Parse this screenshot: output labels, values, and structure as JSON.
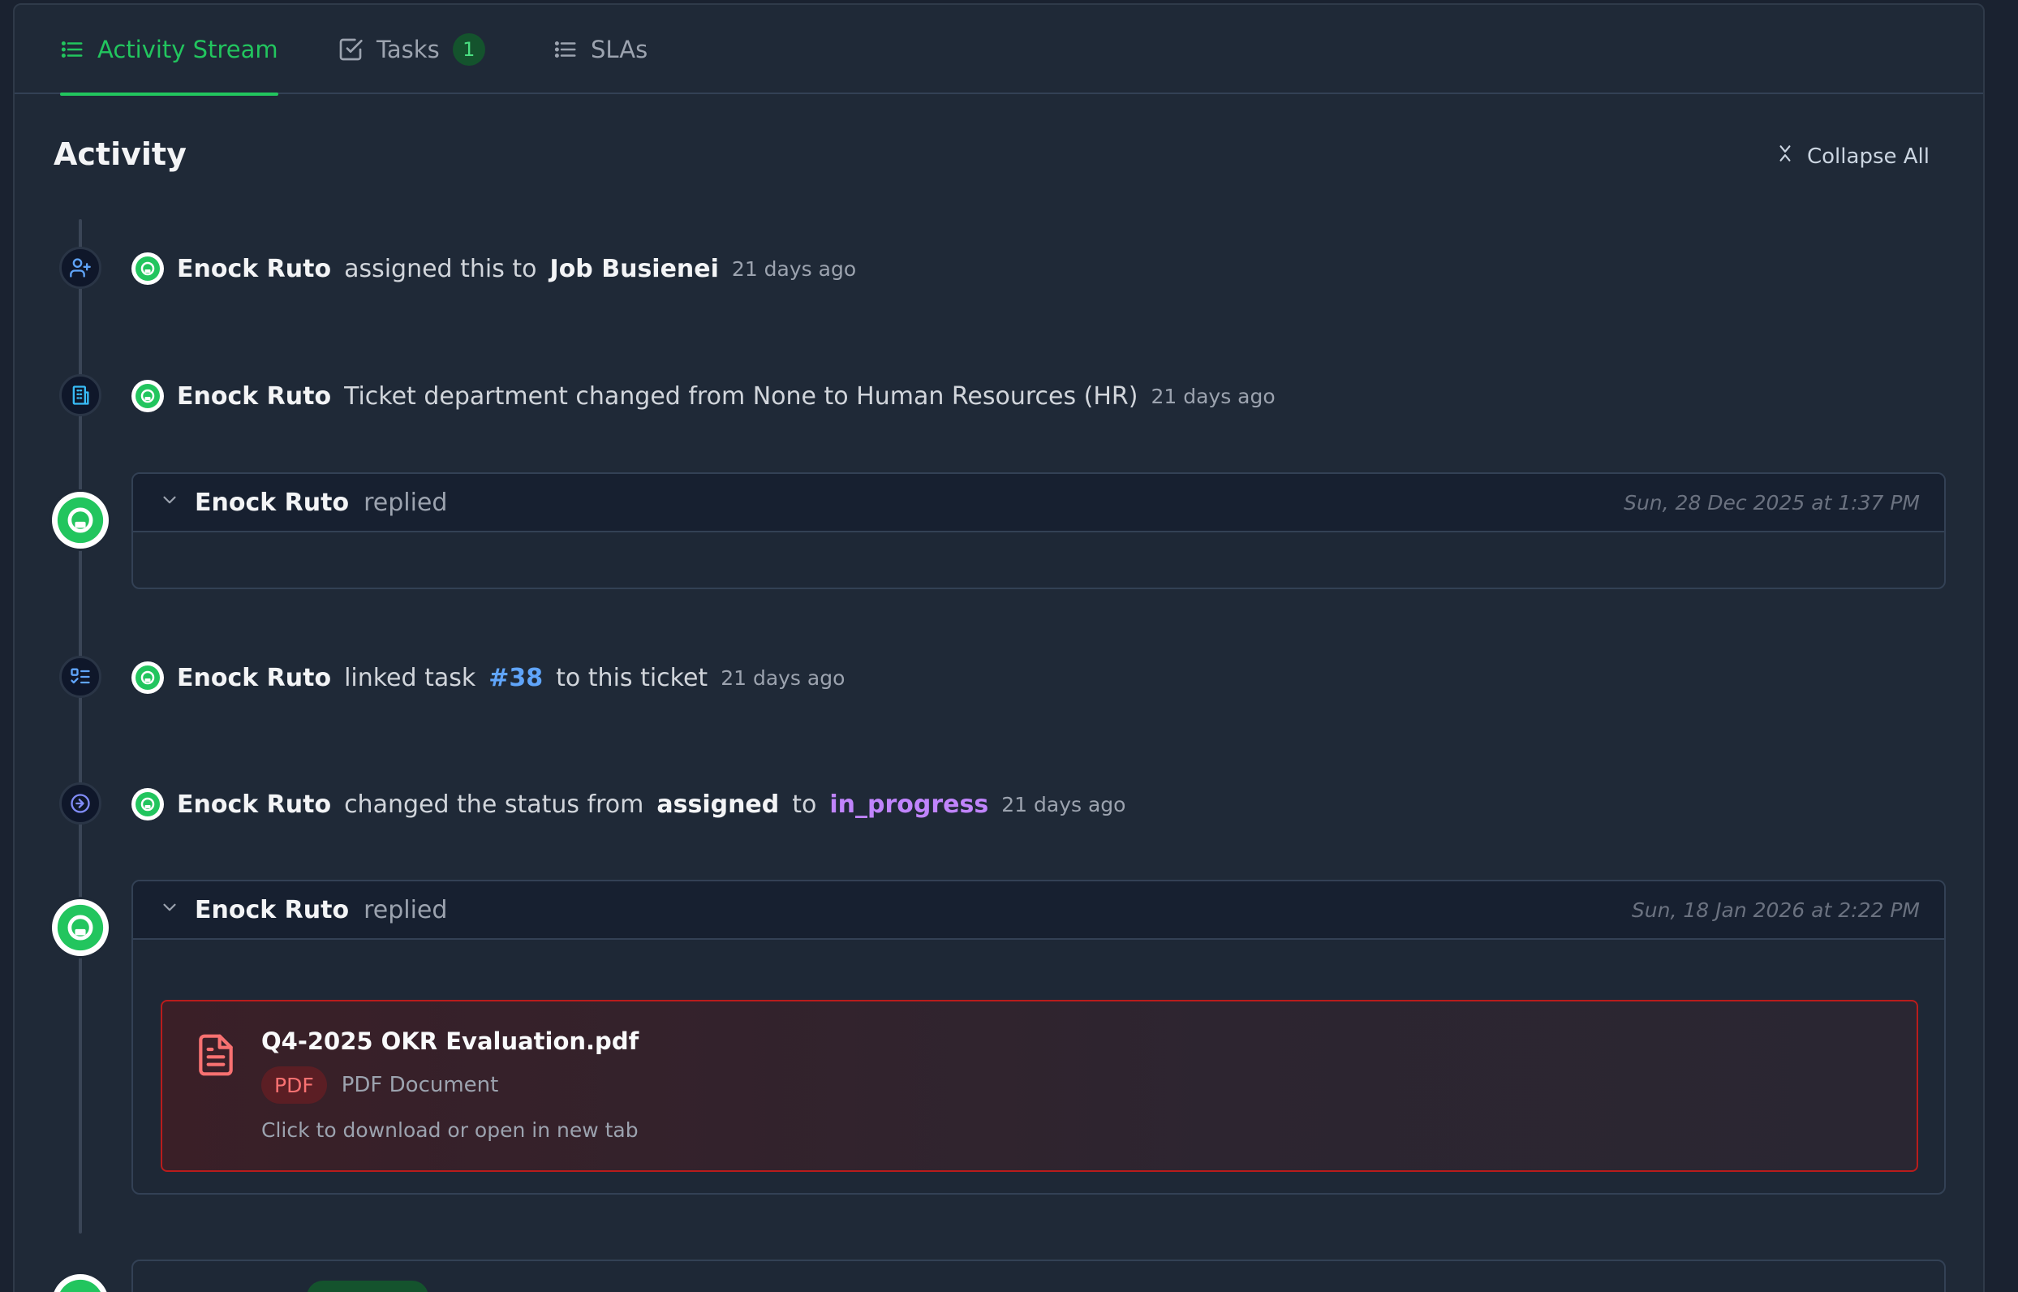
{
  "tabs": [
    {
      "label": "Activity Stream",
      "icon": "list-icon",
      "active": true
    },
    {
      "label": "Tasks",
      "icon": "checkbox-icon",
      "badge": "1",
      "active": false
    },
    {
      "label": "SLAs",
      "icon": "list-icon",
      "active": false
    }
  ],
  "activity": {
    "title": "Activity",
    "collapse_label": "Collapse All"
  },
  "events": [
    {
      "actor": "Enock Ruto",
      "text": "assigned this to",
      "target": "Job Busienei",
      "time": "21 days ago",
      "icon": "user-plus-icon"
    },
    {
      "actor": "Enock Ruto",
      "text": "Ticket department changed from None to Human Resources (HR)",
      "time": "21 days ago",
      "icon": "building-icon"
    },
    {
      "actor": "Enock Ruto",
      "verb": "replied",
      "date": "Sun, 28 Dec 2025 at 1:37 PM"
    },
    {
      "actor": "Enock Ruto",
      "text": "linked task",
      "task": "#38",
      "text2": "to this ticket",
      "time": "21 days ago",
      "icon": "task-list-icon"
    },
    {
      "actor": "Enock Ruto",
      "text": "changed the status from",
      "from": "assigned",
      "to_word": "to",
      "to": "in_progress",
      "time": "21 days ago",
      "icon": "arrow-circle-icon"
    },
    {
      "actor": "Enock Ruto",
      "verb": "replied",
      "date": "Sun, 18 Jan 2026 at 2:22 PM",
      "attachment": {
        "name": "Q4-2025 OKR Evaluation.pdf",
        "type": "PDF",
        "kind": "PDF Document",
        "hint": "Click to download or open in new tab"
      }
    }
  ],
  "colors": {
    "accent": "#22c55e",
    "link": "#60a5fa",
    "status": "#c084fc",
    "attachment_border": "#b91c1c"
  }
}
